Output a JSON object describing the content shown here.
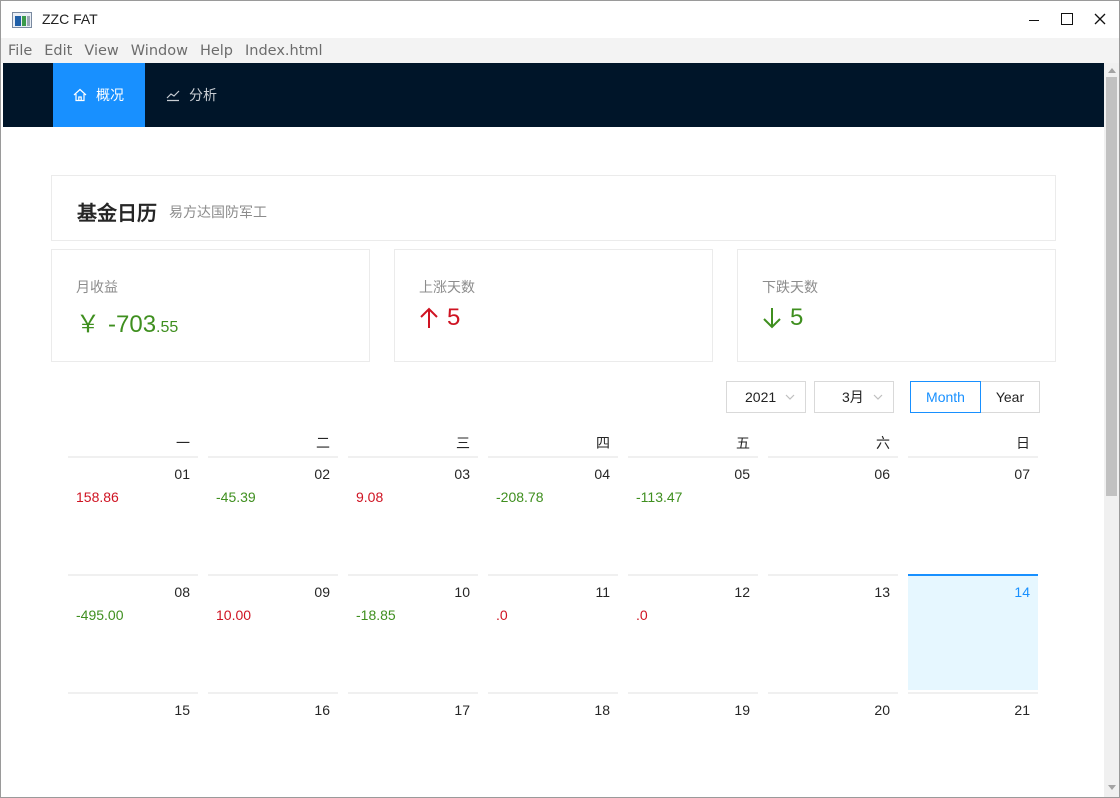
{
  "window": {
    "title": "ZZC FAT"
  },
  "menu": [
    "File",
    "Edit",
    "View",
    "Window",
    "Help",
    "Index.html"
  ],
  "nav": {
    "overview": "概况",
    "analysis": "分析"
  },
  "header": {
    "title": "基金日历",
    "subtitle": "易方达国防军工"
  },
  "stats": {
    "monthly": {
      "label": "月收益",
      "prefix": "￥",
      "int": "-703",
      "decimals": ".55"
    },
    "up_days": {
      "label": "上涨天数",
      "value": "5"
    },
    "down_days": {
      "label": "下跌天数",
      "value": "5"
    }
  },
  "controls": {
    "year": "2021",
    "month": "3月",
    "mode_month": "Month",
    "mode_year": "Year",
    "selected_mode": "Month"
  },
  "colors": {
    "accent": "#1890ff",
    "nav_bg": "#001529",
    "gain": "#cf1322",
    "loss": "#3f8f1f"
  },
  "calendar": {
    "weekdays": [
      "一",
      "二",
      "三",
      "四",
      "五",
      "六",
      "日"
    ],
    "today": "14",
    "weeks": [
      [
        {
          "date": "01",
          "value": "158.86",
          "trend": "up"
        },
        {
          "date": "02",
          "value": "-45.39",
          "trend": "down"
        },
        {
          "date": "03",
          "value": "9.08",
          "trend": "up"
        },
        {
          "date": "04",
          "value": "-208.78",
          "trend": "down"
        },
        {
          "date": "05",
          "value": "-113.47",
          "trend": "down"
        },
        {
          "date": "06",
          "value": "",
          "trend": ""
        },
        {
          "date": "07",
          "value": "",
          "trend": ""
        }
      ],
      [
        {
          "date": "08",
          "value": "-495.00",
          "trend": "down"
        },
        {
          "date": "09",
          "value": "10.00",
          "trend": "up"
        },
        {
          "date": "10",
          "value": "-18.85",
          "trend": "down"
        },
        {
          "date": "11",
          "value": ".0",
          "trend": "up"
        },
        {
          "date": "12",
          "value": ".0",
          "trend": "up"
        },
        {
          "date": "13",
          "value": "",
          "trend": ""
        },
        {
          "date": "14",
          "value": "",
          "trend": ""
        }
      ],
      [
        {
          "date": "15",
          "value": "",
          "trend": ""
        },
        {
          "date": "16",
          "value": "",
          "trend": ""
        },
        {
          "date": "17",
          "value": "",
          "trend": ""
        },
        {
          "date": "18",
          "value": "",
          "trend": ""
        },
        {
          "date": "19",
          "value": "",
          "trend": ""
        },
        {
          "date": "20",
          "value": "",
          "trend": ""
        },
        {
          "date": "21",
          "value": "",
          "trend": ""
        }
      ]
    ]
  }
}
